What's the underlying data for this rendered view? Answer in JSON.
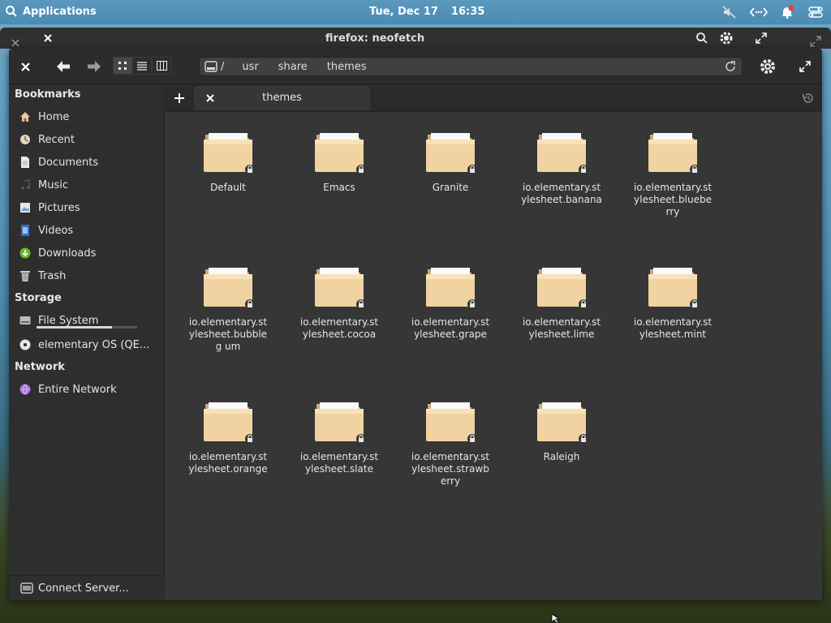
{
  "panel": {
    "applications_label": "Applications",
    "date": "Tue, Dec 17",
    "time": "16:35"
  },
  "background_window": {
    "title": "firefox: neofetch"
  },
  "toolbar": {
    "path_root": "/",
    "breadcrumbs": [
      "usr",
      "share",
      "themes"
    ]
  },
  "sidebar": {
    "bookmarks_header": "Bookmarks",
    "bookmarks": [
      {
        "label": "Home",
        "icon": "home-icon"
      },
      {
        "label": "Recent",
        "icon": "recent-icon"
      },
      {
        "label": "Documents",
        "icon": "documents-icon"
      },
      {
        "label": "Music",
        "icon": "music-icon"
      },
      {
        "label": "Pictures",
        "icon": "pictures-icon"
      },
      {
        "label": "Videos",
        "icon": "videos-icon"
      },
      {
        "label": "Downloads",
        "icon": "downloads-icon"
      },
      {
        "label": "Trash",
        "icon": "trash-icon"
      }
    ],
    "storage_header": "Storage",
    "storage": [
      {
        "label": "File System",
        "usage_fraction": 0.75
      },
      {
        "label": "elementary OS (QE..."
      }
    ],
    "network_header": "Network",
    "network": [
      {
        "label": "Entire Network"
      }
    ],
    "connect_label": "Connect Server..."
  },
  "tabs": [
    {
      "label": "themes"
    }
  ],
  "files": [
    {
      "name": "Default"
    },
    {
      "name": "Emacs"
    },
    {
      "name": "Granite"
    },
    {
      "name": "io.elementary.st ylesheet.banana"
    },
    {
      "name": "io.elementary.st ylesheet.bluebe rry"
    },
    {
      "name": "io.elementary.st ylesheet.bubbleg um"
    },
    {
      "name": "io.elementary.st ylesheet.cocoa"
    },
    {
      "name": "io.elementary.st ylesheet.grape"
    },
    {
      "name": "io.elementary.st ylesheet.lime"
    },
    {
      "name": "io.elementary.st ylesheet.mint"
    },
    {
      "name": "io.elementary.st ylesheet.orange"
    },
    {
      "name": "io.elementary.st ylesheet.slate"
    },
    {
      "name": "io.elementary.st ylesheet.strawb erry"
    },
    {
      "name": "Raleigh"
    }
  ],
  "colors": {
    "panel": "#4c8bb2",
    "folder": "#f0d3a0",
    "window_bg": "#363636",
    "notification_accent": "#e0453c"
  }
}
